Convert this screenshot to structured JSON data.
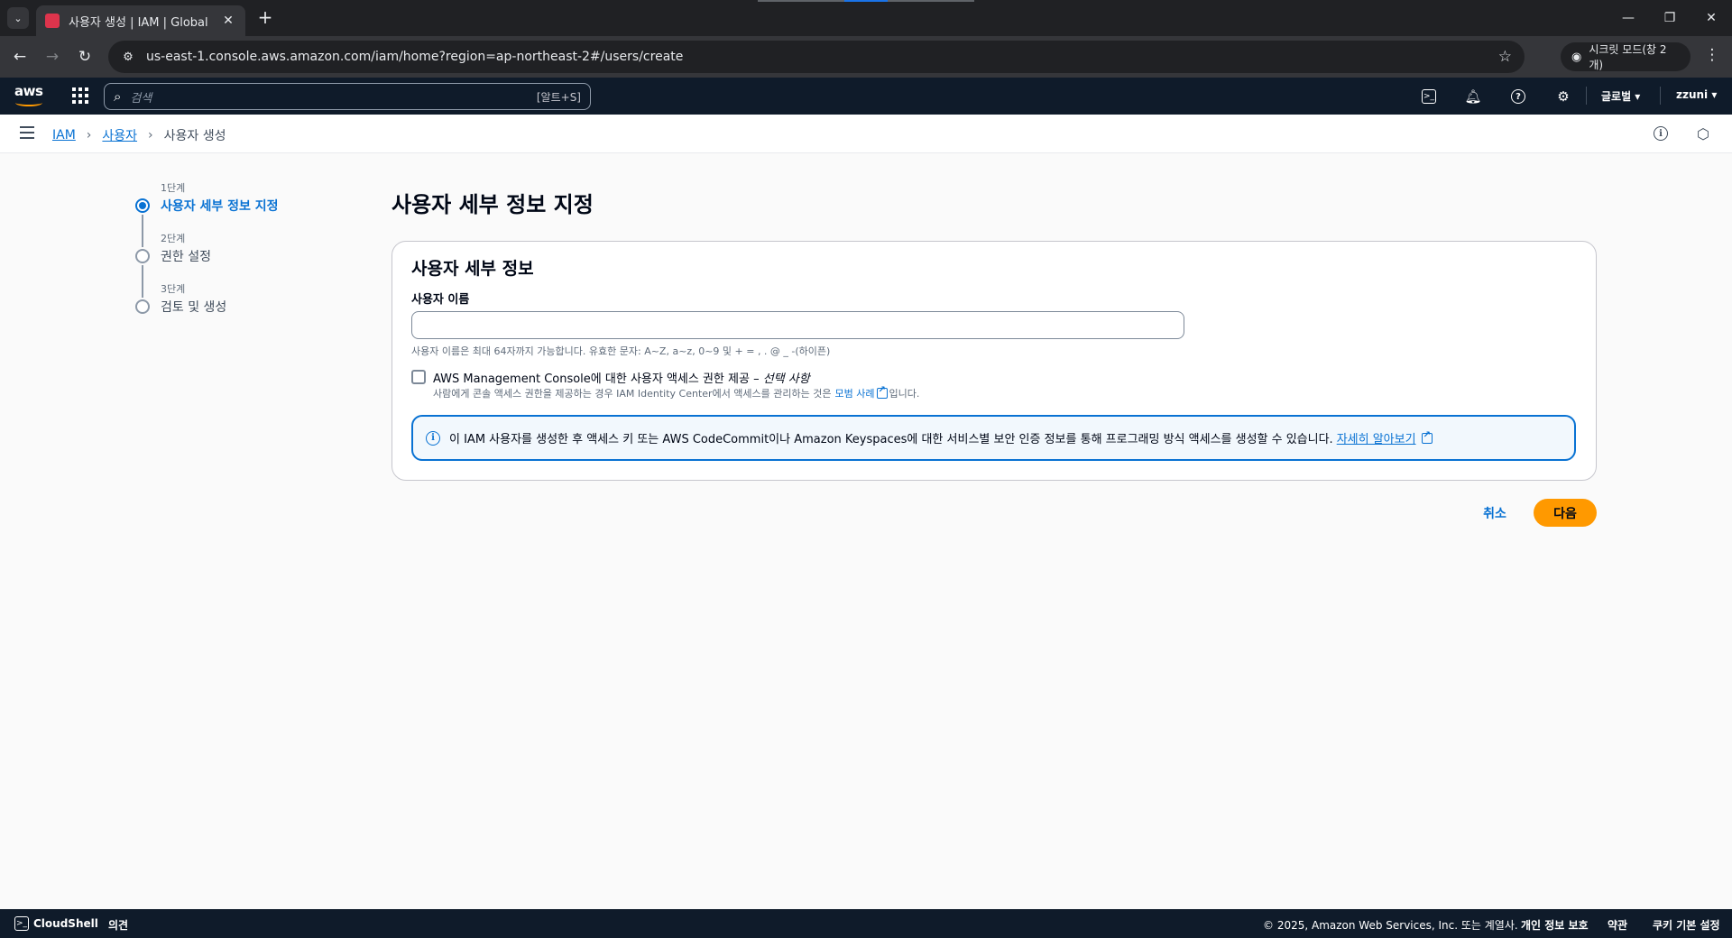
{
  "browser": {
    "tab_title": "사용자 생성 | IAM | Global",
    "url": "us-east-1.console.aws.amazon.com/iam/home?region=ap-northeast-2#/users/create",
    "incognito_label": "시크릿 모드(창 2개)"
  },
  "aws_header": {
    "logo_text": "aws",
    "search_placeholder": "검색",
    "search_shortcut": "[알트+S]",
    "region_label": "글로벌 ▾",
    "user_label": "zzuni ▾"
  },
  "breadcrumb": {
    "items": [
      {
        "label": "IAM"
      },
      {
        "label": "사용자"
      },
      {
        "label": "사용자 생성"
      }
    ]
  },
  "steps": [
    {
      "number": "1단계",
      "label": "사용자 세부 정보 지정",
      "active": true
    },
    {
      "number": "2단계",
      "label": "권한 설정",
      "active": false
    },
    {
      "number": "3단계",
      "label": "검토 및 생성",
      "active": false
    }
  ],
  "main": {
    "page_title": "사용자 세부 정보 지정",
    "panel_title": "사용자 세부 정보",
    "username_label": "사용자 이름",
    "username_value": "",
    "username_constraint": "사용자 이름은 최대 64자까지 가능합니다. 유효한 문자: A~Z, a~z, 0~9 및 + = , . @ _ -(하이픈)",
    "console_access_label": "AWS Management Console에 대한 사용자 액세스 권한 제공 – ",
    "console_access_optional": "선택 사항",
    "console_access_desc_before": "사람에게 콘솔 액세스 권한을 제공하는 경우 IAM Identity Center에서 액세스를 관리하는 것은 ",
    "console_access_desc_link": "모범 사례",
    "console_access_desc_after": "입니다.",
    "info_alert_text": "이 IAM 사용자를 생성한 후 액세스 키 또는 AWS CodeCommit이나 Amazon Keyspaces에 대한 서비스별 보안 인증 정보를 통해 프로그래밍 방식 액세스를 생성할 수 있습니다.",
    "info_alert_link": "자세히 알아보기",
    "cancel_label": "취소",
    "next_label": "다음"
  },
  "footer": {
    "cloudshell": "CloudShell",
    "feedback": "의견",
    "copyright": "© 2025, Amazon Web Services, Inc. 또는 계열사.",
    "privacy": "개인 정보 보호",
    "terms": "약관",
    "cookies": "쿠키 기본 설정"
  },
  "colors": {
    "link": "#0972d3",
    "primary_button": "#ff9900",
    "header_bg": "#0f1b2a"
  }
}
